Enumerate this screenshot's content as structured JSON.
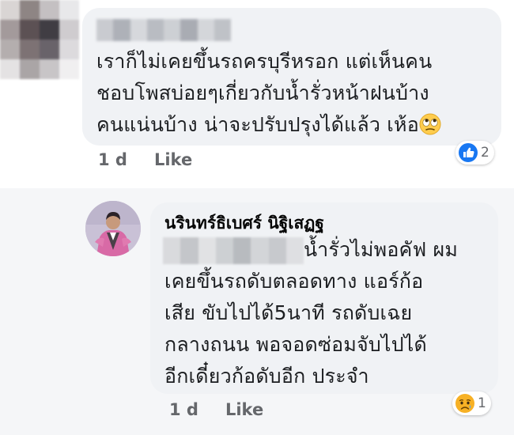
{
  "comment_1": {
    "text_lines": [
      "เราก็ไม่เคยขึ้นรถครบุรีหรอก แต่เห็นคน",
      "ชอบโพสบ่อยๆเกี่ยวกับน้ำรั่วหน้าฝนบ้าง",
      "คนแน่นบ้าง น่าจะปรับปรุงได้แล้ว เห้อ"
    ],
    "trailing_emoji": "rolling-eyes-emoji",
    "reaction": {
      "icon": "like-reaction-icon",
      "count": "2",
      "color": "#1877f2"
    },
    "time": "1 d",
    "like_label": "Like"
  },
  "reply_1": {
    "author": "นรินทร์ธิเบศร์ นิฐิเสฏฐ",
    "text_first_line": "น้ำรั่วไม่พอคัฟ ผม",
    "text_lines": [
      "เคยขึ้นรถดับตลอดทาง แอร์ก้อ",
      "เสีย ขับไปได้5นาที รถดับเฉย",
      "กลางถนน พอจอดซ่อมจับไปได้",
      "อีกเดี๋ยวก้อดับอีก ประจำ"
    ],
    "reaction": {
      "icon": "sad-reaction-icon",
      "count": "1",
      "color": "#f7b125"
    },
    "time": "1 d",
    "like_label": "Like"
  },
  "colors": {
    "bubble": "#f0f2f5",
    "reply_background": "#f5f6f8",
    "meta_text": "#65676b",
    "body_text": "#1c1e21"
  }
}
